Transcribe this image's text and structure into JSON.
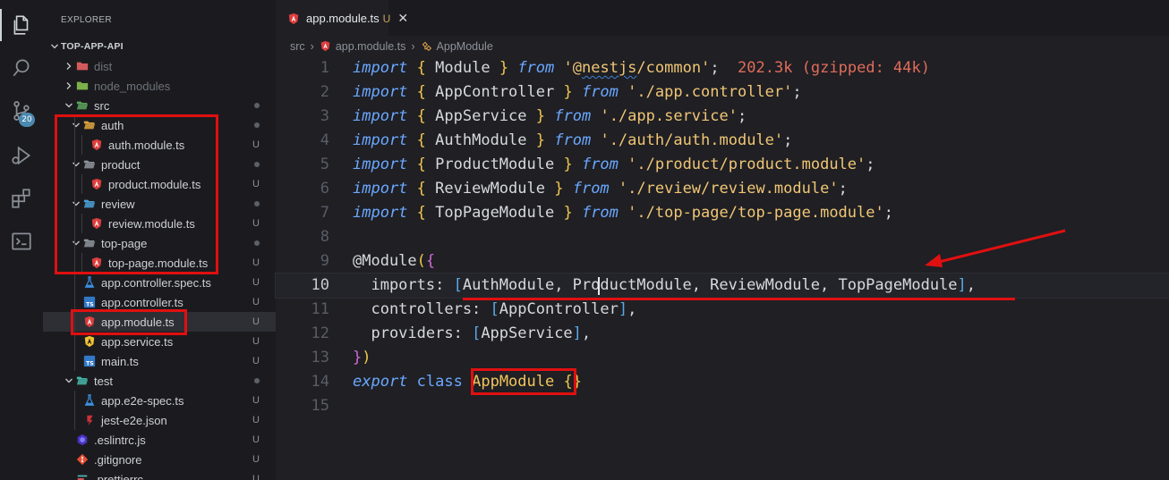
{
  "activity_bar": {
    "items": [
      {
        "name": "explorer",
        "icon": "files-icon"
      },
      {
        "name": "search",
        "icon": "search-icon"
      },
      {
        "name": "source-control",
        "icon": "source-control-icon",
        "badge": "20"
      },
      {
        "name": "run-debug",
        "icon": "run-debug-icon"
      },
      {
        "name": "extensions",
        "icon": "extensions-icon"
      },
      {
        "name": "remote-explorer",
        "icon": "remote-explorer-icon"
      }
    ]
  },
  "sidebar": {
    "title": "EXPLORER",
    "root": "TOP-APP-API",
    "tree": [
      {
        "label": "dist",
        "kind": "folder",
        "depth": 1,
        "collapsed": true,
        "dim": true,
        "icon": "folder-dist-icon"
      },
      {
        "label": "node_modules",
        "kind": "folder",
        "depth": 1,
        "collapsed": true,
        "dim": true,
        "icon": "folder-node-icon"
      },
      {
        "label": "src",
        "kind": "folder",
        "depth": 1,
        "collapsed": false,
        "icon": "folder-src-icon",
        "status": "dot"
      },
      {
        "label": "auth",
        "kind": "folder",
        "depth": 2,
        "collapsed": false,
        "icon": "folder-auth-icon",
        "status": "dot"
      },
      {
        "label": "auth.module.ts",
        "kind": "file",
        "depth": 3,
        "icon": "angular-icon",
        "status": "U"
      },
      {
        "label": "product",
        "kind": "folder",
        "depth": 2,
        "collapsed": false,
        "icon": "folder-icon",
        "status": "dot"
      },
      {
        "label": "product.module.ts",
        "kind": "file",
        "depth": 3,
        "icon": "angular-icon",
        "status": "U"
      },
      {
        "label": "review",
        "kind": "folder",
        "depth": 2,
        "collapsed": false,
        "icon": "folder-review-icon",
        "status": "dot"
      },
      {
        "label": "review.module.ts",
        "kind": "file",
        "depth": 3,
        "icon": "angular-icon",
        "status": "U"
      },
      {
        "label": "top-page",
        "kind": "folder",
        "depth": 2,
        "collapsed": false,
        "icon": "folder-icon",
        "status": "dot"
      },
      {
        "label": "top-page.module.ts",
        "kind": "file",
        "depth": 3,
        "icon": "angular-icon",
        "status": "U"
      },
      {
        "label": "app.controller.spec.ts",
        "kind": "file",
        "depth": 2,
        "icon": "test-flask-icon",
        "status": "U"
      },
      {
        "label": "app.controller.ts",
        "kind": "file",
        "depth": 2,
        "icon": "typescript-icon",
        "status": "U"
      },
      {
        "label": "app.module.ts",
        "kind": "file",
        "depth": 2,
        "icon": "angular-icon",
        "status": "U",
        "selected": true
      },
      {
        "label": "app.service.ts",
        "kind": "file",
        "depth": 2,
        "icon": "angular-service-icon",
        "status": "U"
      },
      {
        "label": "main.ts",
        "kind": "file",
        "depth": 2,
        "icon": "typescript-icon",
        "status": "U"
      },
      {
        "label": "test",
        "kind": "folder",
        "depth": 1,
        "collapsed": false,
        "icon": "folder-test-icon",
        "status": "dot"
      },
      {
        "label": "app.e2e-spec.ts",
        "kind": "file",
        "depth": 2,
        "icon": "test-flask-icon",
        "status": "U"
      },
      {
        "label": "jest-e2e.json",
        "kind": "file",
        "depth": 2,
        "icon": "jest-icon",
        "status": "U"
      },
      {
        "label": ".eslintrc.js",
        "kind": "file",
        "depth": 1,
        "icon": "eslint-icon",
        "status": "U"
      },
      {
        "label": ".gitignore",
        "kind": "file",
        "depth": 1,
        "icon": "git-icon",
        "status": "U"
      },
      {
        "label": ".prettierrc",
        "kind": "file",
        "depth": 1,
        "icon": "prettier-icon",
        "status": "U"
      }
    ]
  },
  "editor": {
    "tab": {
      "label": "app.module.ts",
      "status": "U",
      "close": "✕"
    },
    "breadcrumb": [
      "src",
      "app.module.ts",
      "AppModule"
    ],
    "current_line": 10,
    "lines": [
      {
        "n": "1",
        "tokens": [
          [
            "kw",
            "import"
          ],
          [
            "punc",
            " "
          ],
          [
            "br1",
            "{"
          ],
          [
            "ident",
            " Module "
          ],
          [
            "br1",
            "}"
          ],
          [
            "punc",
            " "
          ],
          [
            "kw",
            "from"
          ],
          [
            "punc",
            " "
          ],
          [
            "str",
            "'@"
          ],
          [
            "strsq",
            "nestjs"
          ],
          [
            "str",
            "/common'"
          ],
          [
            "punc",
            ";"
          ],
          [
            "punc",
            "  "
          ],
          [
            "hint",
            "202.3k (gzipped: 44k)"
          ]
        ]
      },
      {
        "n": "2",
        "tokens": [
          [
            "kw",
            "import"
          ],
          [
            "punc",
            " "
          ],
          [
            "br1",
            "{"
          ],
          [
            "ident",
            " AppController "
          ],
          [
            "br1",
            "}"
          ],
          [
            "punc",
            " "
          ],
          [
            "kw",
            "from"
          ],
          [
            "punc",
            " "
          ],
          [
            "str",
            "'./app.controller'"
          ],
          [
            "punc",
            ";"
          ]
        ]
      },
      {
        "n": "3",
        "tokens": [
          [
            "kw",
            "import"
          ],
          [
            "punc",
            " "
          ],
          [
            "br1",
            "{"
          ],
          [
            "ident",
            " AppService "
          ],
          [
            "br1",
            "}"
          ],
          [
            "punc",
            " "
          ],
          [
            "kw",
            "from"
          ],
          [
            "punc",
            " "
          ],
          [
            "str",
            "'./app.service'"
          ],
          [
            "punc",
            ";"
          ]
        ]
      },
      {
        "n": "4",
        "tokens": [
          [
            "kw",
            "import"
          ],
          [
            "punc",
            " "
          ],
          [
            "br1",
            "{"
          ],
          [
            "ident",
            " AuthModule "
          ],
          [
            "br1",
            "}"
          ],
          [
            "punc",
            " "
          ],
          [
            "kw",
            "from"
          ],
          [
            "punc",
            " "
          ],
          [
            "str",
            "'./auth/auth.module'"
          ],
          [
            "punc",
            ";"
          ]
        ]
      },
      {
        "n": "5",
        "tokens": [
          [
            "kw",
            "import"
          ],
          [
            "punc",
            " "
          ],
          [
            "br1",
            "{"
          ],
          [
            "ident",
            " ProductModule "
          ],
          [
            "br1",
            "}"
          ],
          [
            "punc",
            " "
          ],
          [
            "kw",
            "from"
          ],
          [
            "punc",
            " "
          ],
          [
            "str",
            "'./product/product.module'"
          ],
          [
            "punc",
            ";"
          ]
        ]
      },
      {
        "n": "6",
        "tokens": [
          [
            "kw",
            "import"
          ],
          [
            "punc",
            " "
          ],
          [
            "br1",
            "{"
          ],
          [
            "ident",
            " ReviewModule "
          ],
          [
            "br1",
            "}"
          ],
          [
            "punc",
            " "
          ],
          [
            "kw",
            "from"
          ],
          [
            "punc",
            " "
          ],
          [
            "str",
            "'./review/review.module'"
          ],
          [
            "punc",
            ";"
          ]
        ]
      },
      {
        "n": "7",
        "tokens": [
          [
            "kw",
            "import"
          ],
          [
            "punc",
            " "
          ],
          [
            "br1",
            "{"
          ],
          [
            "ident",
            " TopPageModule "
          ],
          [
            "br1",
            "}"
          ],
          [
            "punc",
            " "
          ],
          [
            "kw",
            "from"
          ],
          [
            "punc",
            " "
          ],
          [
            "str",
            "'./top-page/top-page.module'"
          ],
          [
            "punc",
            ";"
          ]
        ]
      },
      {
        "n": "8",
        "tokens": []
      },
      {
        "n": "9",
        "tokens": [
          [
            "deco",
            "@Module"
          ],
          [
            "br1",
            "("
          ],
          [
            "br2",
            "{"
          ]
        ]
      },
      {
        "n": "10",
        "tokens": [
          [
            "ident",
            "  imports: "
          ],
          [
            "br3",
            "["
          ],
          [
            "ident",
            "AuthModule, ProductModule, ReviewModule, TopPageModule"
          ],
          [
            "br3",
            "]"
          ],
          [
            "punc",
            ","
          ]
        ]
      },
      {
        "n": "11",
        "tokens": [
          [
            "ident",
            "  controllers: "
          ],
          [
            "br3",
            "["
          ],
          [
            "ident",
            "AppController"
          ],
          [
            "br3",
            "]"
          ],
          [
            "punc",
            ","
          ]
        ]
      },
      {
        "n": "12",
        "tokens": [
          [
            "ident",
            "  providers: "
          ],
          [
            "br3",
            "["
          ],
          [
            "ident",
            "AppService"
          ],
          [
            "br3",
            "]"
          ],
          [
            "punc",
            ","
          ]
        ]
      },
      {
        "n": "13",
        "tokens": [
          [
            "br2",
            "}"
          ],
          [
            "br1",
            ")"
          ]
        ]
      },
      {
        "n": "14",
        "tokens": [
          [
            "kw",
            "export"
          ],
          [
            "punc",
            " "
          ],
          [
            "kwn",
            "class"
          ],
          [
            "punc",
            " "
          ],
          [
            "cls",
            "AppModule"
          ],
          [
            "punc",
            " "
          ],
          [
            "br1",
            "{}"
          ]
        ]
      },
      {
        "n": "15",
        "tokens": []
      }
    ]
  },
  "colors": {
    "annotation": "#e01010",
    "badge": "#4b8ab0",
    "git_untracked": "#c9a15b"
  }
}
